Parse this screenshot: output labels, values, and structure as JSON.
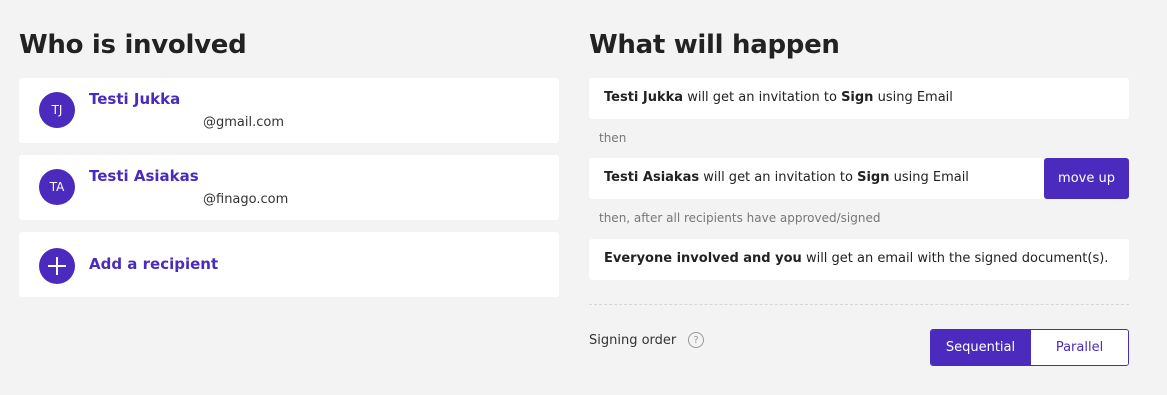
{
  "left": {
    "title": "Who is involved",
    "recipients": [
      {
        "initials": "TJ",
        "name": "Testi Jukka",
        "email": "@gmail.com"
      },
      {
        "initials": "TA",
        "name": "Testi Asiakas",
        "email": "@finago.com"
      }
    ],
    "add_label": "Add a recipient"
  },
  "right": {
    "title": "What will happen",
    "steps": [
      {
        "who": "Testi Jukka",
        "mid": " will get an invitation to ",
        "action": "Sign",
        "tail": " using Email"
      },
      {
        "who": "Testi Asiakas",
        "mid": " will get an invitation to ",
        "action": "Sign",
        "tail": " using Email"
      }
    ],
    "connector1": "then",
    "connector2": "then, after all recipients have approved/signed",
    "move_up_label": "move up",
    "final": {
      "who": "Everyone involved and you",
      "tail": " will get an email with the signed document(s)."
    },
    "signing_order_label": "Signing order",
    "help_glyph": "?",
    "order_options": [
      "Sequential",
      "Parallel"
    ],
    "order_selected": "Sequential"
  },
  "colors": {
    "accent": "#4a2bbd",
    "background": "#f3f3f3"
  }
}
